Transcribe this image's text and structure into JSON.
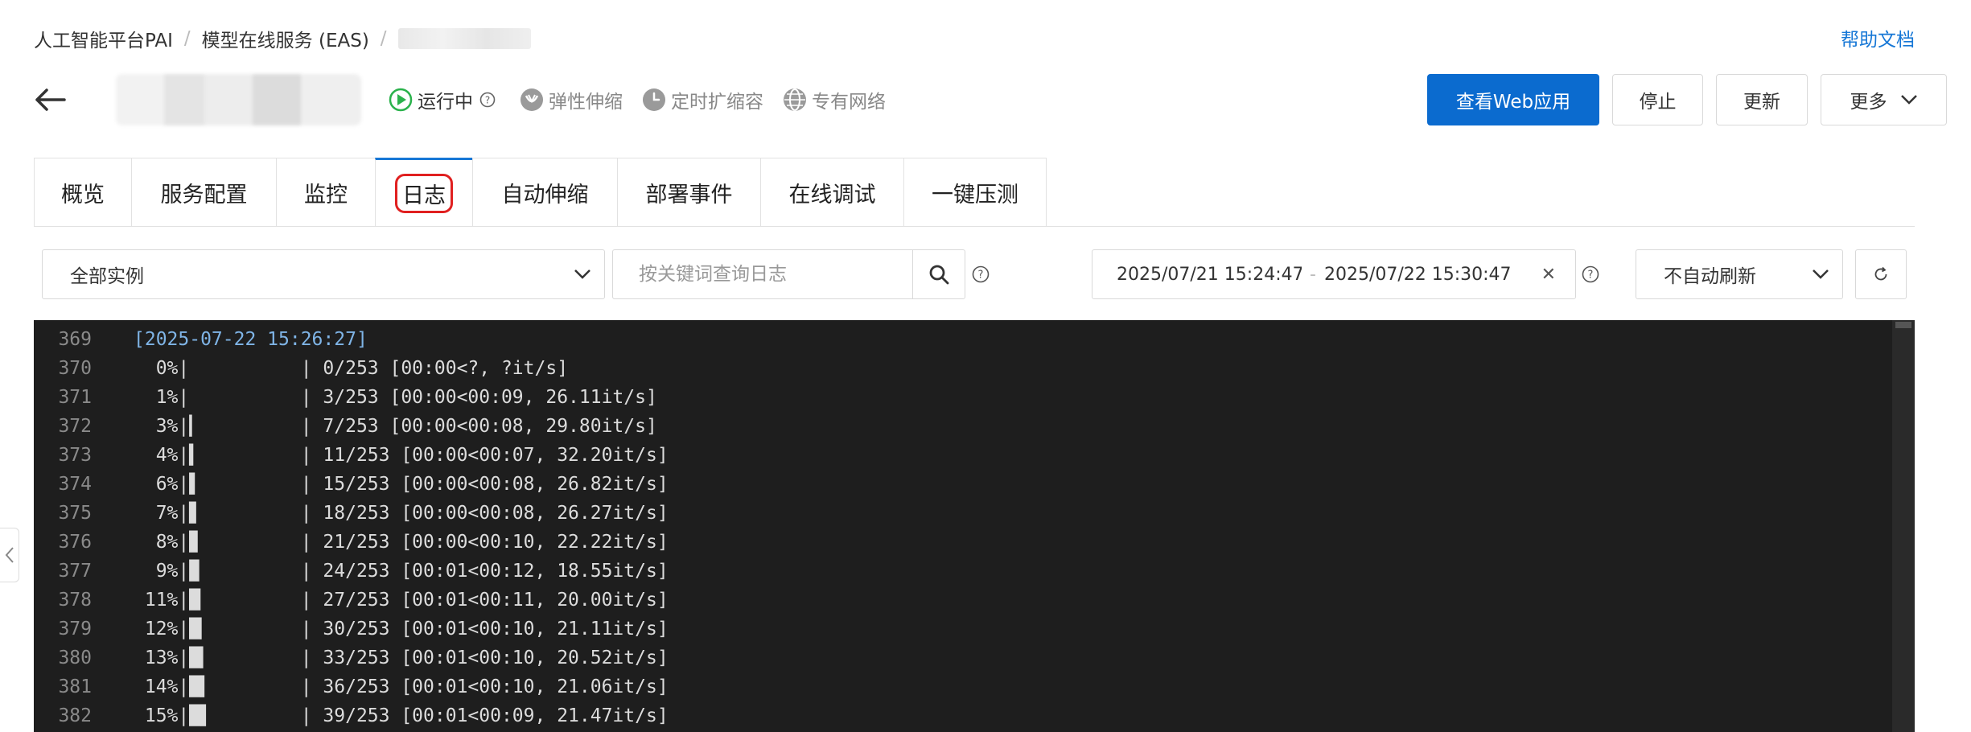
{
  "breadcrumb": {
    "items": [
      "人工智能平台PAI",
      "模型在线服务 (EAS)"
    ]
  },
  "help_link": "帮助文档",
  "status": {
    "running": "运行中",
    "elastic": "弹性伸缩",
    "scheduled": "定时扩缩容",
    "vpc": "专有网络"
  },
  "actions": {
    "view_web": "查看Web应用",
    "stop": "停止",
    "update": "更新",
    "more": "更多"
  },
  "tabs": [
    {
      "label": "概览"
    },
    {
      "label": "服务配置"
    },
    {
      "label": "监控"
    },
    {
      "label": "日志",
      "active": true
    },
    {
      "label": "自动伸缩"
    },
    {
      "label": "部署事件"
    },
    {
      "label": "在线调试"
    },
    {
      "label": "一键压测"
    }
  ],
  "filters": {
    "instance": "全部实例",
    "search_placeholder": "按关键词查询日志",
    "date_start": "2025/07/21 15:24:47",
    "date_end": "2025/07/22 15:30:47",
    "refresh": "不自动刷新"
  },
  "log": [
    {
      "n": "369",
      "text": "[2025-07-22 15:26:27]",
      "ts": true
    },
    {
      "n": "370",
      "text": "  0%|          | 0/253 [00:00<?, ?it/s]"
    },
    {
      "n": "371",
      "text": "  1%|          | 3/253 [00:00<00:09, 26.11it/s]"
    },
    {
      "n": "372",
      "text": "  3%|▎         | 7/253 [00:00<00:08, 29.80it/s]"
    },
    {
      "n": "373",
      "text": "  4%|▍         | 11/253 [00:00<00:07, 32.20it/s]"
    },
    {
      "n": "374",
      "text": "  6%|▌         | 15/253 [00:00<00:08, 26.82it/s]"
    },
    {
      "n": "375",
      "text": "  7%|▋         | 18/253 [00:00<00:08, 26.27it/s]"
    },
    {
      "n": "376",
      "text": "  8%|▊         | 21/253 [00:00<00:10, 22.22it/s]"
    },
    {
      "n": "377",
      "text": "  9%|▉         | 24/253 [00:01<00:12, 18.55it/s]"
    },
    {
      "n": "378",
      "text": " 11%|█         | 27/253 [00:01<00:11, 20.00it/s]"
    },
    {
      "n": "379",
      "text": " 12%|█▏        | 30/253 [00:01<00:10, 21.11it/s]"
    },
    {
      "n": "380",
      "text": " 13%|█▎        | 33/253 [00:01<00:10, 20.52it/s]"
    },
    {
      "n": "381",
      "text": " 14%|█▍        | 36/253 [00:01<00:10, 21.06it/s]"
    },
    {
      "n": "382",
      "text": " 15%|█▌        | 39/253 [00:01<00:09, 21.47it/s]"
    }
  ],
  "colors": {
    "primary": "#0b6bcf",
    "link": "#1677d6",
    "running_green": "#2bb24c",
    "highlight_red": "#e02020",
    "log_bg": "#1e1e1e"
  },
  "icons": [
    "back-arrow-icon",
    "play-circle-icon",
    "question-icon",
    "elastic-icon",
    "clock-icon",
    "network-globe-icon",
    "chevron-down-icon",
    "search-icon",
    "close-icon",
    "refresh-icon",
    "chevron-left-icon"
  ]
}
